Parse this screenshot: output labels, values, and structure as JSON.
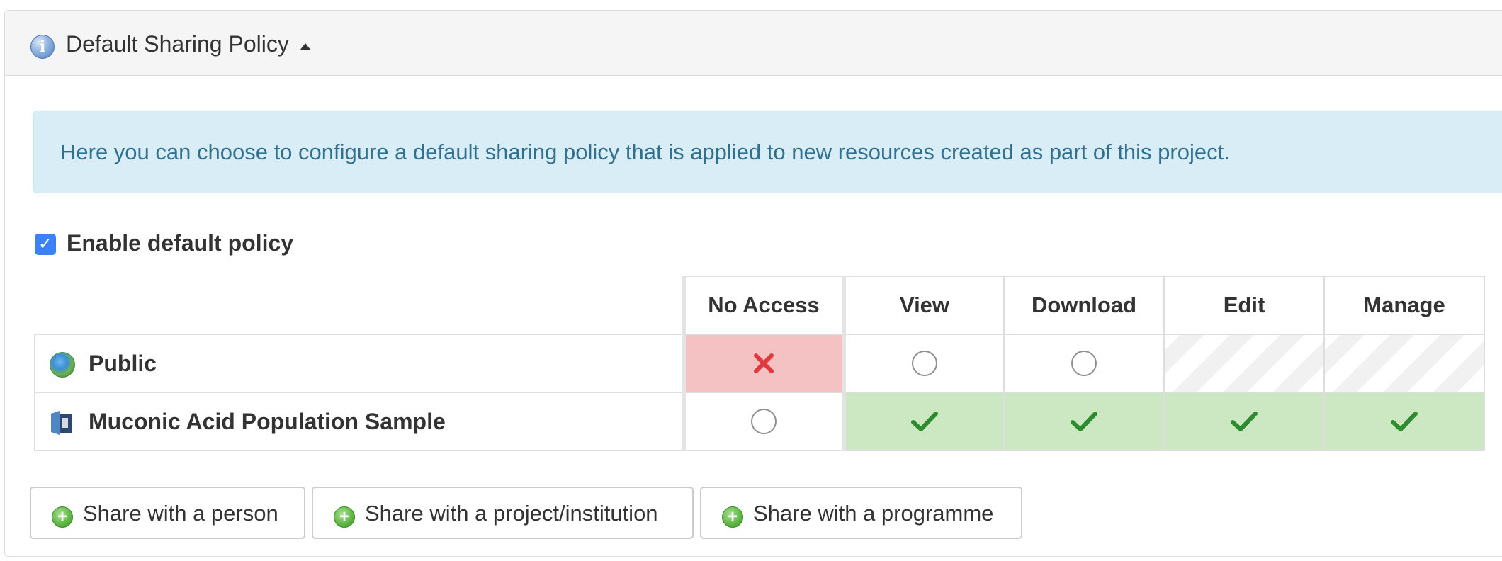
{
  "panel": {
    "heading": {
      "icon": "info-icon",
      "title": "Default Sharing Policy",
      "toggle_icon": "caret-up-icon"
    },
    "alert": {
      "text": "Here you can choose to configure a default sharing policy that is applied to new resources created as part of this project."
    },
    "enable_policy": {
      "checked": true,
      "label": "Enable default policy"
    },
    "permissions_table": {
      "columns": [
        "No Access",
        "View",
        "Download",
        "Edit",
        "Manage"
      ],
      "rows": [
        {
          "label": "Public",
          "icon": "globe-icon",
          "cells": [
            "selected-no-access",
            "radio",
            "radio",
            "unavailable",
            "unavailable"
          ]
        },
        {
          "label": "Muconic Acid Population Sample",
          "icon": "project-icon",
          "cells": [
            "radio",
            "granted",
            "granted",
            "granted",
            "granted"
          ]
        }
      ]
    },
    "share_buttons": [
      {
        "label": "Share with a person",
        "icon": "add-icon"
      },
      {
        "label": "Share with a project/institution",
        "icon": "add-icon"
      },
      {
        "label": "Share with a programme",
        "icon": "add-icon"
      }
    ]
  },
  "colors": {
    "alert_background": "#d9edf7",
    "alert_text": "#31708f",
    "no_access_selected": "#f4c2c2",
    "granted": "#cce8c3",
    "checkbox": "#3b82f6"
  }
}
